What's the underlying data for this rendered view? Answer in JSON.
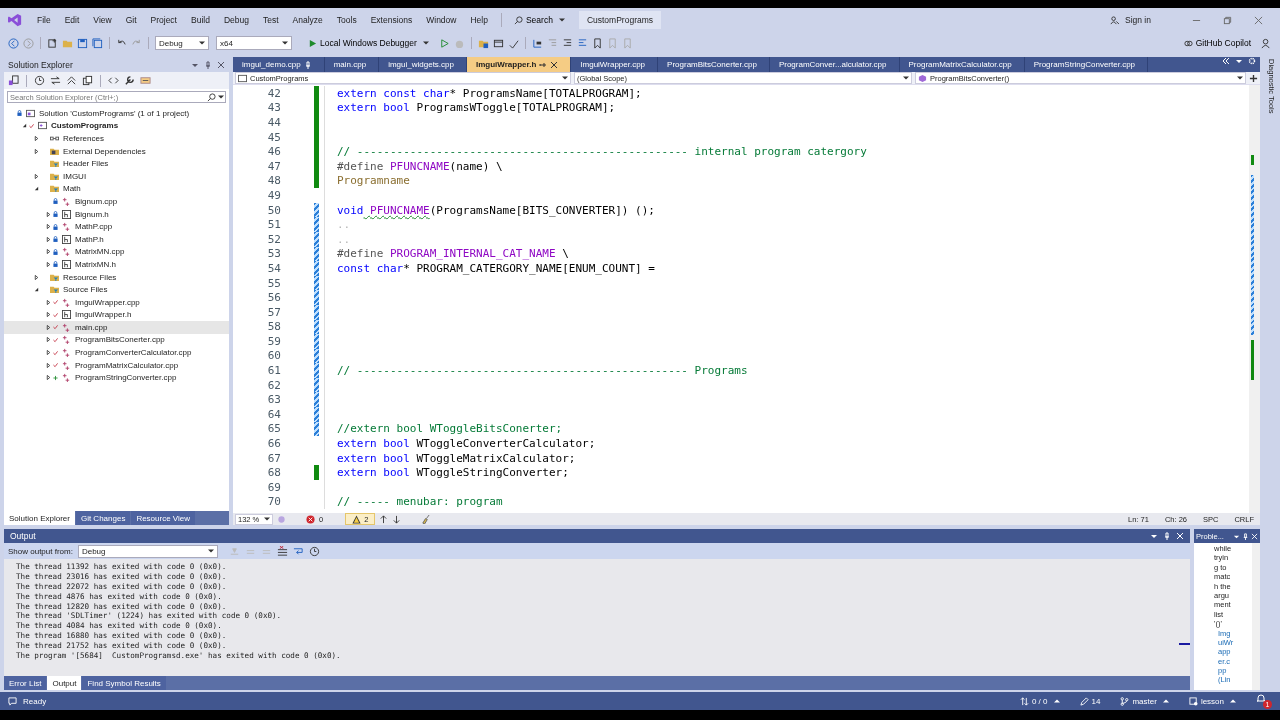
{
  "menu_bar": {
    "items": [
      "File",
      "Edit",
      "View",
      "Git",
      "Project",
      "Build",
      "Debug",
      "Test",
      "Analyze",
      "Tools",
      "Extensions",
      "Window",
      "Help"
    ],
    "search": "Search",
    "solution_name": "CustomPrograms",
    "sign_in": "Sign in"
  },
  "toolbar": {
    "configuration": "Debug",
    "platform": "x64",
    "run": "Local Windows Debugger",
    "copilot": "GitHub Copilot"
  },
  "solution_explorer": {
    "title": "Solution Explorer",
    "search_placeholder": "Search Solution Explorer (Ctrl+;)",
    "tree": [
      {
        "label": "Solution 'CustomPrograms' (1 of 1 project)",
        "kind": "solution",
        "expandable": false,
        "locked": true,
        "modified": false,
        "added": false,
        "selected": false,
        "children": [
          {
            "label": "CustomPrograms",
            "kind": "project",
            "expandable": true,
            "expanded": true,
            "locked": false,
            "modified": true,
            "added": false,
            "selected": false,
            "children": [
              {
                "label": "References",
                "kind": "references",
                "expandable": true,
                "expanded": false,
                "locked": false,
                "modified": false,
                "added": false,
                "selected": false
              },
              {
                "label": "External Dependencies",
                "kind": "dependencies",
                "expandable": true,
                "expanded": false,
                "locked": false,
                "modified": false,
                "added": false,
                "selected": false
              },
              {
                "label": "Header Files",
                "kind": "filter",
                "expandable": false,
                "locked": false,
                "modified": false,
                "added": false,
                "selected": false
              },
              {
                "label": "IMGUI",
                "kind": "filter",
                "expandable": true,
                "expanded": false,
                "locked": false,
                "modified": false,
                "added": false,
                "selected": false
              },
              {
                "label": "Math",
                "kind": "filter",
                "expandable": true,
                "expanded": true,
                "locked": false,
                "modified": false,
                "added": false,
                "selected": false,
                "children": [
                  {
                    "label": "Bignum.cpp",
                    "kind": "source",
                    "expandable": false,
                    "locked": true,
                    "modified": false,
                    "added": false,
                    "selected": false
                  },
                  {
                    "label": "Bignum.h",
                    "kind": "header",
                    "expandable": true,
                    "expanded": false,
                    "locked": true,
                    "modified": false,
                    "added": false,
                    "selected": false
                  },
                  {
                    "label": "MathP.cpp",
                    "kind": "source",
                    "expandable": true,
                    "expanded": false,
                    "locked": true,
                    "modified": false,
                    "added": false,
                    "selected": false
                  },
                  {
                    "label": "MathP.h",
                    "kind": "header",
                    "expandable": true,
                    "expanded": false,
                    "locked": true,
                    "modified": false,
                    "added": false,
                    "selected": false
                  },
                  {
                    "label": "MatrixMN.cpp",
                    "kind": "source",
                    "expandable": true,
                    "expanded": false,
                    "locked": true,
                    "modified": false,
                    "added": false,
                    "selected": false
                  },
                  {
                    "label": "MatrixMN.h",
                    "kind": "header",
                    "expandable": true,
                    "expanded": false,
                    "locked": true,
                    "modified": false,
                    "added": false,
                    "selected": false
                  }
                ]
              },
              {
                "label": "Resource Files",
                "kind": "filter",
                "expandable": true,
                "expanded": false,
                "locked": false,
                "modified": false,
                "added": false,
                "selected": false
              },
              {
                "label": "Source Files",
                "kind": "filter",
                "expandable": true,
                "expanded": true,
                "locked": false,
                "modified": false,
                "added": false,
                "selected": false,
                "children": [
                  {
                    "label": "ImguiWrapper.cpp",
                    "kind": "source",
                    "expandable": true,
                    "expanded": false,
                    "locked": false,
                    "modified": true,
                    "added": false,
                    "selected": false
                  },
                  {
                    "label": "ImguiWrapper.h",
                    "kind": "header",
                    "expandable": true,
                    "expanded": false,
                    "locked": false,
                    "modified": true,
                    "added": false,
                    "selected": false
                  },
                  {
                    "label": "main.cpp",
                    "kind": "source",
                    "expandable": true,
                    "expanded": false,
                    "locked": false,
                    "modified": true,
                    "added": false,
                    "selected": true
                  },
                  {
                    "label": "ProgramBitsConerter.cpp",
                    "kind": "source",
                    "expandable": true,
                    "expanded": false,
                    "locked": false,
                    "modified": true,
                    "added": false,
                    "selected": false
                  },
                  {
                    "label": "ProgramConverterCalculator.cpp",
                    "kind": "source",
                    "expandable": true,
                    "expanded": false,
                    "locked": false,
                    "modified": true,
                    "added": false,
                    "selected": false
                  },
                  {
                    "label": "ProgramMatrixCalculator.cpp",
                    "kind": "source",
                    "expandable": true,
                    "expanded": false,
                    "locked": false,
                    "modified": true,
                    "added": false,
                    "selected": false
                  },
                  {
                    "label": "ProgramStringConverter.cpp",
                    "kind": "source",
                    "expandable": true,
                    "expanded": false,
                    "locked": false,
                    "modified": false,
                    "added": true,
                    "selected": false
                  }
                ]
              }
            ]
          }
        ]
      }
    ],
    "tabs": [
      {
        "label": "Solution Explorer",
        "selected": true
      },
      {
        "label": "Git Changes",
        "selected": false
      },
      {
        "label": "Resource View",
        "selected": false
      }
    ]
  },
  "editor": {
    "tabs": [
      {
        "label": "imgui_demo.cpp",
        "selected": false,
        "pinned": true
      },
      {
        "label": "main.cpp",
        "selected": false,
        "pinned": false
      },
      {
        "label": "imgui_widgets.cpp",
        "selected": false,
        "pinned": false
      },
      {
        "label": "ImguiWrapper.h",
        "selected": true,
        "pinned": false
      },
      {
        "label": "ImguiWrapper.cpp",
        "selected": false,
        "pinned": false
      },
      {
        "label": "ProgramBitsConerter.cpp",
        "selected": false,
        "pinned": false
      },
      {
        "label": "ProgramConver...alculator.cpp",
        "selected": false,
        "pinned": false
      },
      {
        "label": "ProgramMatrixCalculator.cpp",
        "selected": false,
        "pinned": false
      },
      {
        "label": "ProgramStringConverter.cpp",
        "selected": false,
        "pinned": false
      }
    ],
    "nav": {
      "project": "CustomPrograms",
      "scope": "(Global Scope)",
      "member": "ProgramBitsConverter()"
    },
    "lines": [
      {
        "number": "42",
        "modified": true,
        "saved": true,
        "tokens": [
          {
            "text": "extern const char",
            "kind": "keyword"
          },
          {
            "text": "* ProgramsName[TOTALPROGRAM];",
            "kind": "plain"
          }
        ]
      },
      {
        "number": "43",
        "modified": true,
        "saved": true,
        "tokens": [
          {
            "text": "extern bool",
            "kind": "keyword"
          },
          {
            "text": " ProgramsWToggle[TOTALPROGRAM];",
            "kind": "plain"
          }
        ]
      },
      {
        "number": "44",
        "modified": true,
        "saved": true
      },
      {
        "number": "45",
        "modified": true,
        "saved": true
      },
      {
        "number": "46",
        "modified": true,
        "saved": true,
        "tokens": [
          {
            "text": "// -------------------------------------------------- internal program catergory",
            "kind": "comment"
          }
        ]
      },
      {
        "number": "47",
        "modified": true,
        "saved": true,
        "tokens": [
          {
            "text": "#define",
            "kind": "directive"
          },
          {
            "text": " PFUNCNAME",
            "kind": "macro"
          },
          {
            "text": "(name) \\",
            "kind": "plain"
          }
        ]
      },
      {
        "number": "48",
        "modified": true,
        "saved": true,
        "tokens": [
          {
            "text": "Programname",
            "kind": "parameter"
          }
        ]
      },
      {
        "number": "49",
        "modified": false
      },
      {
        "number": "50",
        "modified": true,
        "saved": false,
        "tokens": [
          {
            "text": "void",
            "kind": "keyword"
          },
          {
            "text": " PFUNCNAME",
            "kind": "macro_error"
          },
          {
            "text": "(ProgramsName[BITS_CONVERTER]) ();",
            "kind": "plain"
          }
        ]
      },
      {
        "number": "51",
        "modified": true,
        "saved": false,
        "tokens": [
          {
            "text": "..",
            "kind": "whitespace"
          }
        ]
      },
      {
        "number": "52",
        "modified": true,
        "saved": false,
        "tokens": [
          {
            "text": "..",
            "kind": "whitespace"
          }
        ]
      },
      {
        "number": "53",
        "modified": true,
        "saved": false,
        "tokens": [
          {
            "text": "#define",
            "kind": "directive"
          },
          {
            "text": " PROGRAM_INTERNAL_CAT_NAME",
            "kind": "macro"
          },
          {
            "text": " \\",
            "kind": "plain"
          }
        ]
      },
      {
        "number": "54",
        "modified": true,
        "saved": false,
        "tokens": [
          {
            "text": "const char",
            "kind": "keyword"
          },
          {
            "text": "* PROGRAM_CATERGORY_NAME[ENUM_COUNT] =",
            "kind": "plain"
          }
        ]
      },
      {
        "number": "55",
        "modified": true,
        "saved": false
      },
      {
        "number": "56",
        "modified": true,
        "saved": false
      },
      {
        "number": "57",
        "modified": true,
        "saved": false
      },
      {
        "number": "58",
        "modified": true,
        "saved": false
      },
      {
        "number": "59",
        "modified": true,
        "saved": false
      },
      {
        "number": "60",
        "modified": true,
        "saved": false
      },
      {
        "number": "61",
        "modified": true,
        "saved": false,
        "tokens": [
          {
            "text": "// -------------------------------------------------- Programs",
            "kind": "comment"
          }
        ]
      },
      {
        "number": "62",
        "modified": true,
        "saved": false
      },
      {
        "number": "63",
        "modified": true,
        "saved": false
      },
      {
        "number": "64",
        "modified": true,
        "saved": false
      },
      {
        "number": "65",
        "modified": true,
        "saved": false,
        "tokens": [
          {
            "text": "//extern bool WToggleBitsConerter;",
            "kind": "comment"
          }
        ]
      },
      {
        "number": "66",
        "modified": false,
        "tokens": [
          {
            "text": "extern bool",
            "kind": "keyword"
          },
          {
            "text": " WToggleConverterCalculator;",
            "kind": "plain"
          }
        ]
      },
      {
        "number": "67",
        "modified": false,
        "tokens": [
          {
            "text": "extern bool",
            "kind": "keyword"
          },
          {
            "text": " WToggleMatrixCalculator;",
            "kind": "plain"
          }
        ]
      },
      {
        "number": "68",
        "modified": true,
        "saved": true,
        "tokens": [
          {
            "text": "extern bool",
            "kind": "keyword"
          },
          {
            "text": " WToggleStringConverter;",
            "kind": "plain"
          }
        ]
      },
      {
        "number": "69",
        "modified": false
      },
      {
        "number": "70",
        "modified": false,
        "tokens": [
          {
            "text": "// ----- menubar: program",
            "kind": "comment"
          }
        ]
      }
    ],
    "zoom": "132 %",
    "errors": "0",
    "warnings": "2",
    "position": [
      "Ln: 71",
      "Ch: 26",
      "SPC",
      "CRLF"
    ]
  },
  "output": {
    "title": "Output",
    "source_label": "Show output from:",
    "source": "Debug",
    "lines": [
      "The thread 11392 has exited with code 0 (0x0).",
      "The thread 23016 has exited with code 0 (0x0).",
      "The thread 22072 has exited with code 0 (0x0).",
      "The thread 4876 has exited with code 0 (0x0).",
      "The thread 12820 has exited with code 0 (0x0).",
      "The thread 'SDLTimer' (1224) has exited with code 0 (0x0).",
      "The thread 4084 has exited with code 0 (0x0).",
      "The thread 16880 has exited with code 0 (0x0).",
      "The thread 21752 has exited with code 0 (0x0).",
      "The program '[5684]  CustomProgramsd.exe' has exited with code 0 (0x0)."
    ],
    "tabs": [
      {
        "label": "Error List",
        "selected": false
      },
      {
        "label": "Output",
        "selected": true
      },
      {
        "label": "Find Symbol Results",
        "selected": false
      }
    ]
  },
  "problems": {
    "title": "Proble...",
    "lines": [
      {
        "text": "while",
        "kind": "text"
      },
      {
        "text": "tryin",
        "kind": "text"
      },
      {
        "text": "g to",
        "kind": "text"
      },
      {
        "text": "matc",
        "kind": "text"
      },
      {
        "text": "h the",
        "kind": "text"
      },
      {
        "text": "argu",
        "kind": "text"
      },
      {
        "text": "ment",
        "kind": "text"
      },
      {
        "text": "list",
        "kind": "text"
      },
      {
        "text": "'()'",
        "kind": "text"
      },
      {
        "text": "Img",
        "kind": "link"
      },
      {
        "text": "uiWr",
        "kind": "link"
      },
      {
        "text": "app",
        "kind": "link"
      },
      {
        "text": "er.c",
        "kind": "link"
      },
      {
        "text": "pp",
        "kind": "link"
      },
      {
        "text": "(Lin",
        "kind": "link"
      }
    ]
  },
  "diagnostic_tools": "Diagnostic Tools",
  "status_bar": {
    "state": "Ready",
    "sync": "0 / 0",
    "changes": "14",
    "branch": "master",
    "repo": "lesson",
    "notifications": "1"
  }
}
